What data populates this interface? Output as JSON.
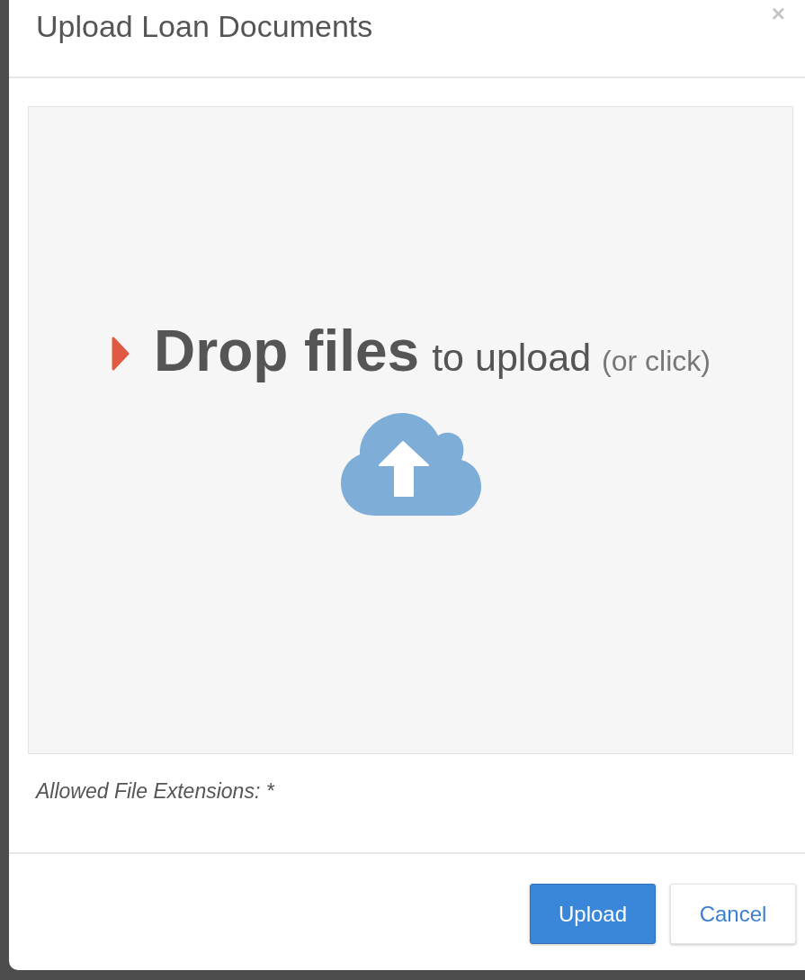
{
  "dialog": {
    "title": "Upload Loan Documents",
    "close": "×"
  },
  "dropzone": {
    "heading": "Drop files",
    "text": "to upload",
    "hint": "(or click)"
  },
  "note": "Allowed File Extensions: *",
  "buttons": [
    {
      "label": "Upload",
      "kind": "primary"
    },
    {
      "label": "Cancel",
      "kind": "default"
    }
  ]
}
